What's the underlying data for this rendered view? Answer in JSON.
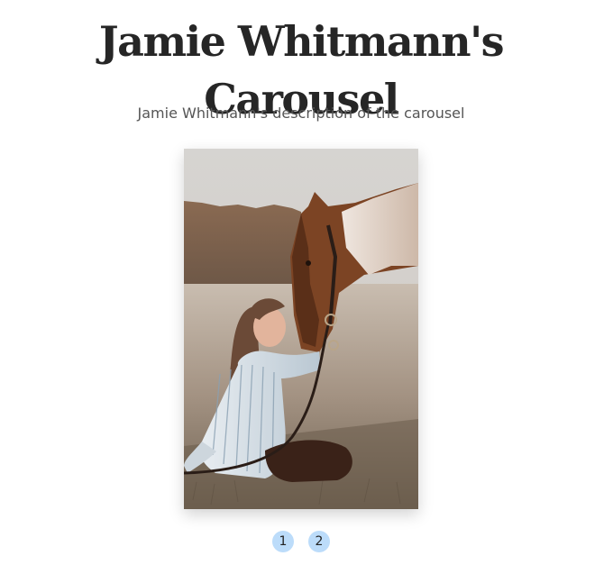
{
  "header": {
    "title": "Jamie Whitmann's Carousel",
    "description": "Jamie Whitmann's description of the carousel"
  },
  "carousel": {
    "active_slide": 1,
    "slide_image": {
      "subject": "woman kissing a horse on the nose in a field"
    },
    "pagination": [
      {
        "label": "1"
      },
      {
        "label": "2"
      }
    ]
  },
  "colors": {
    "title": "#262626",
    "description": "#555555",
    "pagination_dot": "#bcdcfa"
  }
}
